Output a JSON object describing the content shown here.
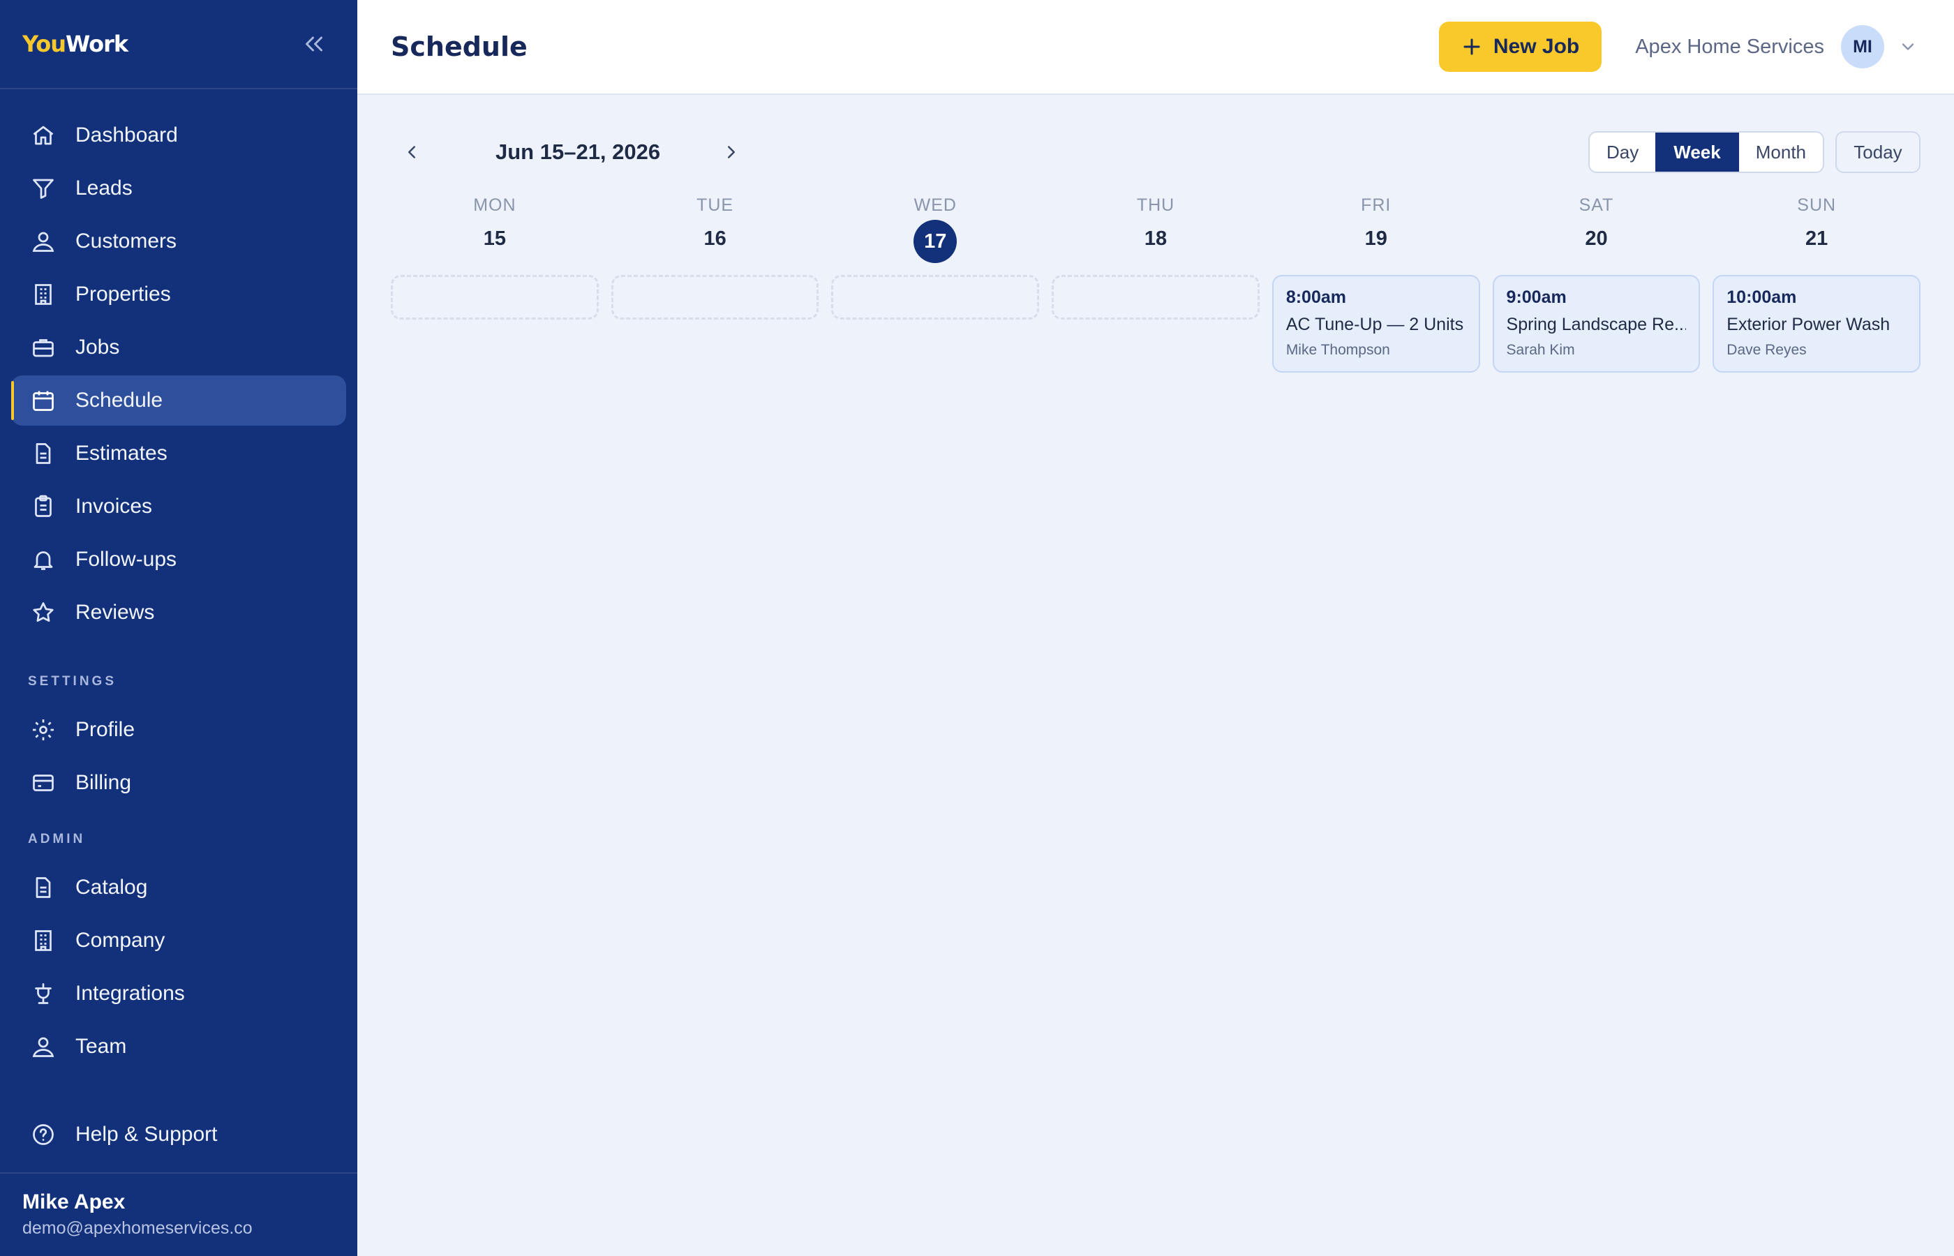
{
  "app": {
    "logo_you": "You",
    "logo_work": "Work"
  },
  "sidebar": {
    "items": [
      {
        "label": "Dashboard",
        "icon": "home-icon"
      },
      {
        "label": "Leads",
        "icon": "funnel-icon"
      },
      {
        "label": "Customers",
        "icon": "user-icon"
      },
      {
        "label": "Properties",
        "icon": "building-icon"
      },
      {
        "label": "Jobs",
        "icon": "briefcase-icon"
      },
      {
        "label": "Schedule",
        "icon": "calendar-icon",
        "active": true
      },
      {
        "label": "Estimates",
        "icon": "document-icon"
      },
      {
        "label": "Invoices",
        "icon": "clipboard-icon"
      },
      {
        "label": "Follow-ups",
        "icon": "bell-icon"
      },
      {
        "label": "Reviews",
        "icon": "star-icon"
      }
    ],
    "settings_heading": "SETTINGS",
    "settings_items": [
      {
        "label": "Profile",
        "icon": "gear-icon"
      },
      {
        "label": "Billing",
        "icon": "card-icon"
      }
    ],
    "admin_heading": "ADMIN",
    "admin_items": [
      {
        "label": "Catalog",
        "icon": "document-icon"
      },
      {
        "label": "Company",
        "icon": "building-icon"
      },
      {
        "label": "Integrations",
        "icon": "plug-icon"
      },
      {
        "label": "Team",
        "icon": "user-icon"
      }
    ],
    "help_label": "Help & Support",
    "user": {
      "name": "Mike Apex",
      "email": "demo@apexhomeservices.co"
    }
  },
  "header": {
    "title": "Schedule",
    "new_job_label": "New Job",
    "company": "Apex Home Services",
    "avatar_initials": "MI"
  },
  "calendar": {
    "range_label": "Jun 15–21, 2026",
    "views": [
      "Day",
      "Week",
      "Month"
    ],
    "active_view": "Week",
    "today_label": "Today",
    "days": [
      {
        "dow": "MON",
        "num": "15"
      },
      {
        "dow": "TUE",
        "num": "16"
      },
      {
        "dow": "WED",
        "num": "17",
        "today": true
      },
      {
        "dow": "THU",
        "num": "18"
      },
      {
        "dow": "FRI",
        "num": "19"
      },
      {
        "dow": "SAT",
        "num": "20"
      },
      {
        "dow": "SUN",
        "num": "21"
      }
    ],
    "events": [
      {
        "day": "FRI",
        "time": "8:00am",
        "title": "AC Tune-Up — 2 Units",
        "person": "Mike Thompson"
      },
      {
        "day": "SAT",
        "time": "9:00am",
        "title": "Spring Landscape Re...",
        "person": "Sarah Kim"
      },
      {
        "day": "SUN",
        "time": "10:00am",
        "title": "Exterior Power Wash",
        "person": "Dave Reyes"
      }
    ]
  },
  "colors": {
    "sidebar_bg": "#12317a",
    "accent_yellow": "#f9c82a",
    "page_bg": "#eef3fb",
    "event_bg": "#e6eefb"
  }
}
